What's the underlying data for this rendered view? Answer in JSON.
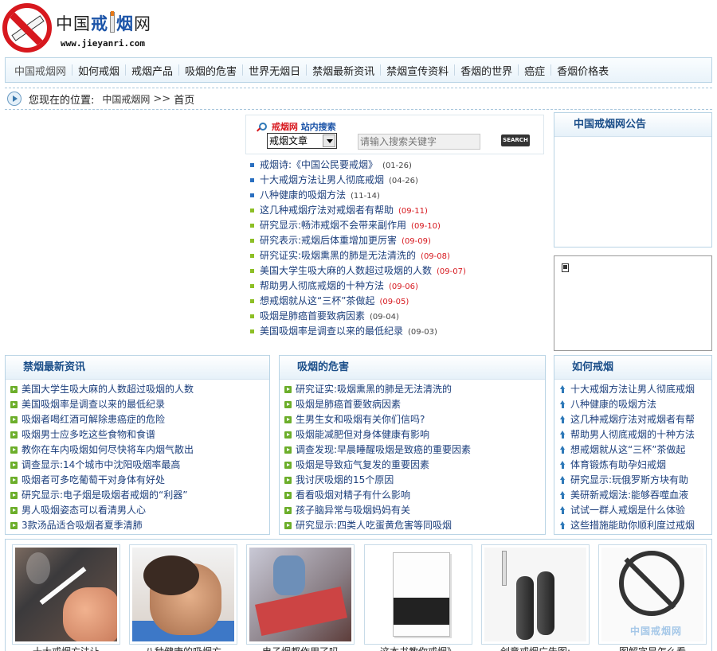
{
  "site": {
    "logo_parts": [
      "中国",
      "戒",
      "烟",
      "网"
    ],
    "url": "www.jieyanri.com"
  },
  "nav": {
    "items": [
      "中国戒烟网",
      "如何戒烟",
      "戒烟产品",
      "吸烟的危害",
      "世界无烟日",
      "禁烟最新资讯",
      "禁烟宣传资料",
      "香烟的世界",
      "癌症",
      "香烟价格表"
    ]
  },
  "breadcrumb": {
    "label": "您现在的位置:",
    "home": "中国戒烟网",
    "separator": ">>",
    "current": "首页"
  },
  "search": {
    "title_red": "戒烟网",
    "title_blue": "站内搜索",
    "select_value": "戒烟文章",
    "placeholder": "请输入搜索关键字",
    "button": "SEARCH"
  },
  "top_list": [
    {
      "title": "戒烟诗:《中国公民要戒烟》",
      "date": "(01-26)",
      "red": false,
      "dot": "blue"
    },
    {
      "title": "十大戒烟方法让男人彻底戒烟",
      "date": "(04-26)",
      "red": false,
      "dot": "blue"
    },
    {
      "title": "八种健康的吸烟方法",
      "date": "(11-14)",
      "red": false,
      "dot": "blue"
    },
    {
      "title": "这几种戒烟疗法对戒烟者有帮助",
      "date": "(09-11)",
      "red": true,
      "dot": "green"
    },
    {
      "title": "研究显示:畅沛戒烟不会带来副作用",
      "date": "(09-10)",
      "red": true,
      "dot": "green"
    },
    {
      "title": "研究表示:戒烟后体重增加更厉害",
      "date": "(09-09)",
      "red": true,
      "dot": "green"
    },
    {
      "title": "研究证实:吸烟熏黑的肺是无法清洗的",
      "date": "(09-08)",
      "red": true,
      "dot": "green"
    },
    {
      "title": "美国大学生吸大麻的人数超过吸烟的人数",
      "date": "(09-07)",
      "red": true,
      "dot": "green"
    },
    {
      "title": "帮助男人彻底戒烟的十种方法",
      "date": "(09-06)",
      "red": true,
      "dot": "green"
    },
    {
      "title": "想戒烟就从这“三杯”茶做起",
      "date": "(09-05)",
      "red": true,
      "dot": "green"
    },
    {
      "title": "吸烟是肺癌首要致病因素",
      "date": "(09-04)",
      "red": false,
      "dot": "green"
    },
    {
      "title": "美国吸烟率是调查以来的最低纪录",
      "date": "(09-03)",
      "red": false,
      "dot": "green"
    }
  ],
  "notice": {
    "title": "中国戒烟网公告"
  },
  "columns": [
    {
      "title": "禁烟最新资讯",
      "icon": "green-arrow-icon",
      "items": [
        "美国大学生吸大麻的人数超过吸烟的人数",
        "美国吸烟率是调查以来的最低纪录",
        "吸烟者喝红酒可解除患癌症的危险",
        "吸烟男士应多吃这些食物和食谱",
        "教你在车内吸烟如何尽快将车内烟气散出",
        "调查显示:14个城市中沈阳吸烟率最高",
        "吸烟者可多吃葡萄干对身体有好处",
        "研究显示:电子烟是吸烟者戒烟的“利器”",
        "男人吸烟姿态可以看清男人心",
        "3款汤品适合吸烟者夏季清肺"
      ]
    },
    {
      "title": "吸烟的危害",
      "icon": "green-arrow-icon",
      "items": [
        "研究证实:吸烟熏黑的肺是无法清洗的",
        "吸烟是肺癌首要致病因素",
        "生男生女和吸烟有关你们信吗?",
        "吸烟能减肥但对身体健康有影响",
        "调查发现:早晨睡醒吸烟是致癌的重要因素",
        "吸烟是导致疝气复发的重要因素",
        "我讨厌吸烟的15个原因",
        "看看吸烟对精子有什么影响",
        "孩子脑异常与吸烟妈妈有关",
        "研究显示:四类人吃蛋黄危害等同吸烟"
      ]
    },
    {
      "title": "如何戒烟",
      "icon": "blue-up-arrow-icon",
      "items": [
        "十大戒烟方法让男人彻底戒烟",
        "八种健康的吸烟方法",
        "这几种戒烟疗法对戒烟者有帮",
        "帮助男人彻底戒烟的十种方法",
        "想戒烟就从这“三杯”茶做起",
        "体育锻炼有助孕妇戒烟",
        "研究显示:玩俄罗斯方块有助",
        "美研新戒烟法:能够吞噬血液",
        "试试一群人戒烟是什么体验",
        "这些措施能助你顺利度过戒烟"
      ]
    }
  ],
  "gallery": {
    "captions": [
      "十大戒烟方法让",
      "八种健康的吸烟方",
      "电子烟都作用了吗",
      "这本书教你戒烟》",
      "创意戒烟广告图:",
      "图解字是怎么看"
    ],
    "watermark": "中国戒烟网"
  }
}
